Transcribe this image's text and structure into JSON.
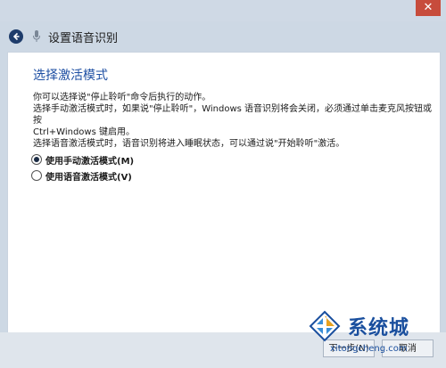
{
  "window": {
    "close_glyph": "✕"
  },
  "nav": {
    "title": "设置语音识别",
    "back_icon": "back-arrow-icon",
    "mic_icon": "microphone-icon"
  },
  "page": {
    "heading": "选择激活模式",
    "desc_line1": "你可以选择说\"停止聆听\"命令后执行的动作。",
    "desc_line2": "选择手动激活模式时，如果说\"停止聆听\"，Windows 语音识别将会关闭，必须通过单击麦克风按钮或按",
    "desc_line3": "Ctrl+Windows 键启用。",
    "desc_line4": "选择语音激活模式时，语音识别将进入睡眠状态，可以通过说\"开始聆听\"激活。"
  },
  "options": [
    {
      "label": "使用手动激活模式(M)",
      "selected": true
    },
    {
      "label": "使用语音激活模式(V)",
      "selected": false
    }
  ],
  "footer": {
    "next_label": "下一步(N)",
    "cancel_label": "取消"
  },
  "watermark": {
    "brand": "系统城",
    "url": "xitongcheng.com"
  },
  "colors": {
    "accent": "#1e4fa3",
    "close": "#c74c3c"
  }
}
